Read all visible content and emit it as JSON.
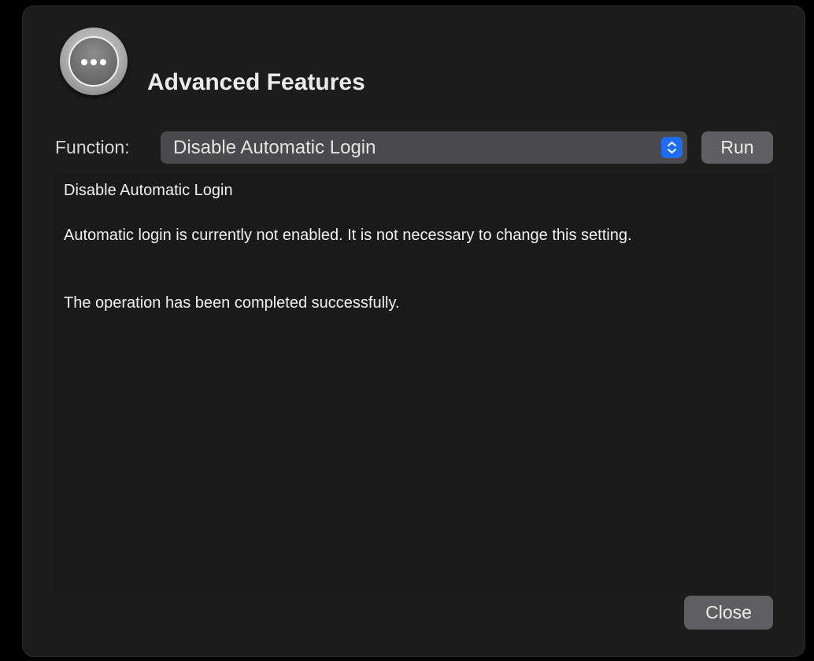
{
  "dialog": {
    "title": "Advanced Features",
    "icon": "more-options-icon"
  },
  "function_row": {
    "label": "Function:",
    "selected": "Disable Automatic Login",
    "run_label": "Run"
  },
  "output": {
    "heading": "Disable Automatic Login",
    "message": "Automatic login is currently not enabled. It is not necessary to change this setting.",
    "status": "The operation has been completed successfully."
  },
  "footer": {
    "close_label": "Close"
  },
  "colors": {
    "window_bg": "#1c1c1d",
    "accent": "#1e6cf0",
    "button_bg": "#5f5f61"
  }
}
